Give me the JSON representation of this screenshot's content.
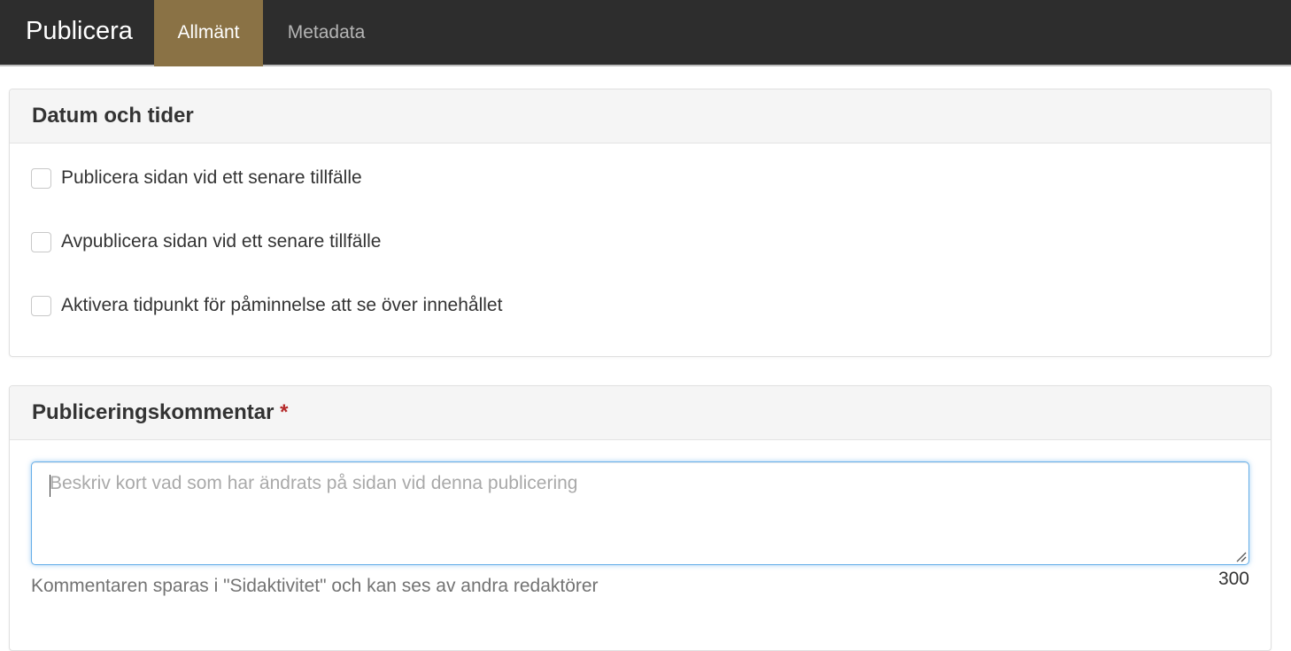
{
  "header": {
    "title": "Publicera",
    "tabs": [
      {
        "label": "Allmänt",
        "active": true
      },
      {
        "label": "Metadata",
        "active": false
      }
    ],
    "active_tab_color": "#8a7245"
  },
  "dates_panel": {
    "title": "Datum och tider",
    "options": [
      {
        "label": "Publicera sidan vid ett senare tillfälle",
        "checked": false
      },
      {
        "label": "Avpublicera sidan vid ett senare tillfälle",
        "checked": false
      },
      {
        "label": "Aktivera tidpunkt för påminnelse att se över innehållet",
        "checked": false
      }
    ]
  },
  "comment_panel": {
    "title": "Publiceringskommentar",
    "required_mark": "*",
    "textarea": {
      "value": "",
      "placeholder": "Beskriv kort vad som har ändrats på sidan vid denna publicering"
    },
    "help_text": "Kommentaren sparas i \"Sidaktivitet\" och kan ses av andra redaktörer",
    "remaining_chars": "300"
  }
}
